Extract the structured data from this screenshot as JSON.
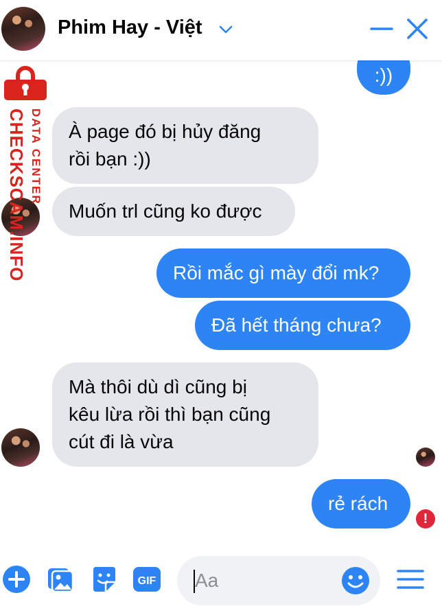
{
  "header": {
    "title": "Phim Hay - Việt"
  },
  "watermark": {
    "line1": "DATA CENTER",
    "line2": "CHECKSCAM.INFO"
  },
  "messages": [
    {
      "side": "out",
      "text": ":))"
    },
    {
      "side": "in",
      "lines": [
        "À page đó bị hủy đăng",
        "rồi bạn :))"
      ]
    },
    {
      "side": "in",
      "lines": [
        "Muốn trl cũng ko được"
      ]
    },
    {
      "side": "out",
      "text": "Rồi mắc gì mày đổi mk?"
    },
    {
      "side": "out",
      "text": "Đã hết tháng chưa?"
    },
    {
      "side": "in",
      "lines": [
        "Mà thôi dù dì cũng bị",
        "kêu lừa rồi thì bạn cũng",
        "cút đi là vừa"
      ]
    },
    {
      "side": "out",
      "text": "rẻ rách"
    }
  ],
  "error_badge": "!",
  "composer": {
    "placeholder": "Aa",
    "icons": [
      "plus-icon",
      "photo-icon",
      "sticker-icon",
      "gif-icon",
      "emoji-icon",
      "menu-icon"
    ],
    "gif_label": "GIF"
  },
  "colors": {
    "accent": "#2d85f5",
    "incoming_bubble": "#e4e6eb",
    "watermark": "#d9231d",
    "error": "#e0263a"
  }
}
